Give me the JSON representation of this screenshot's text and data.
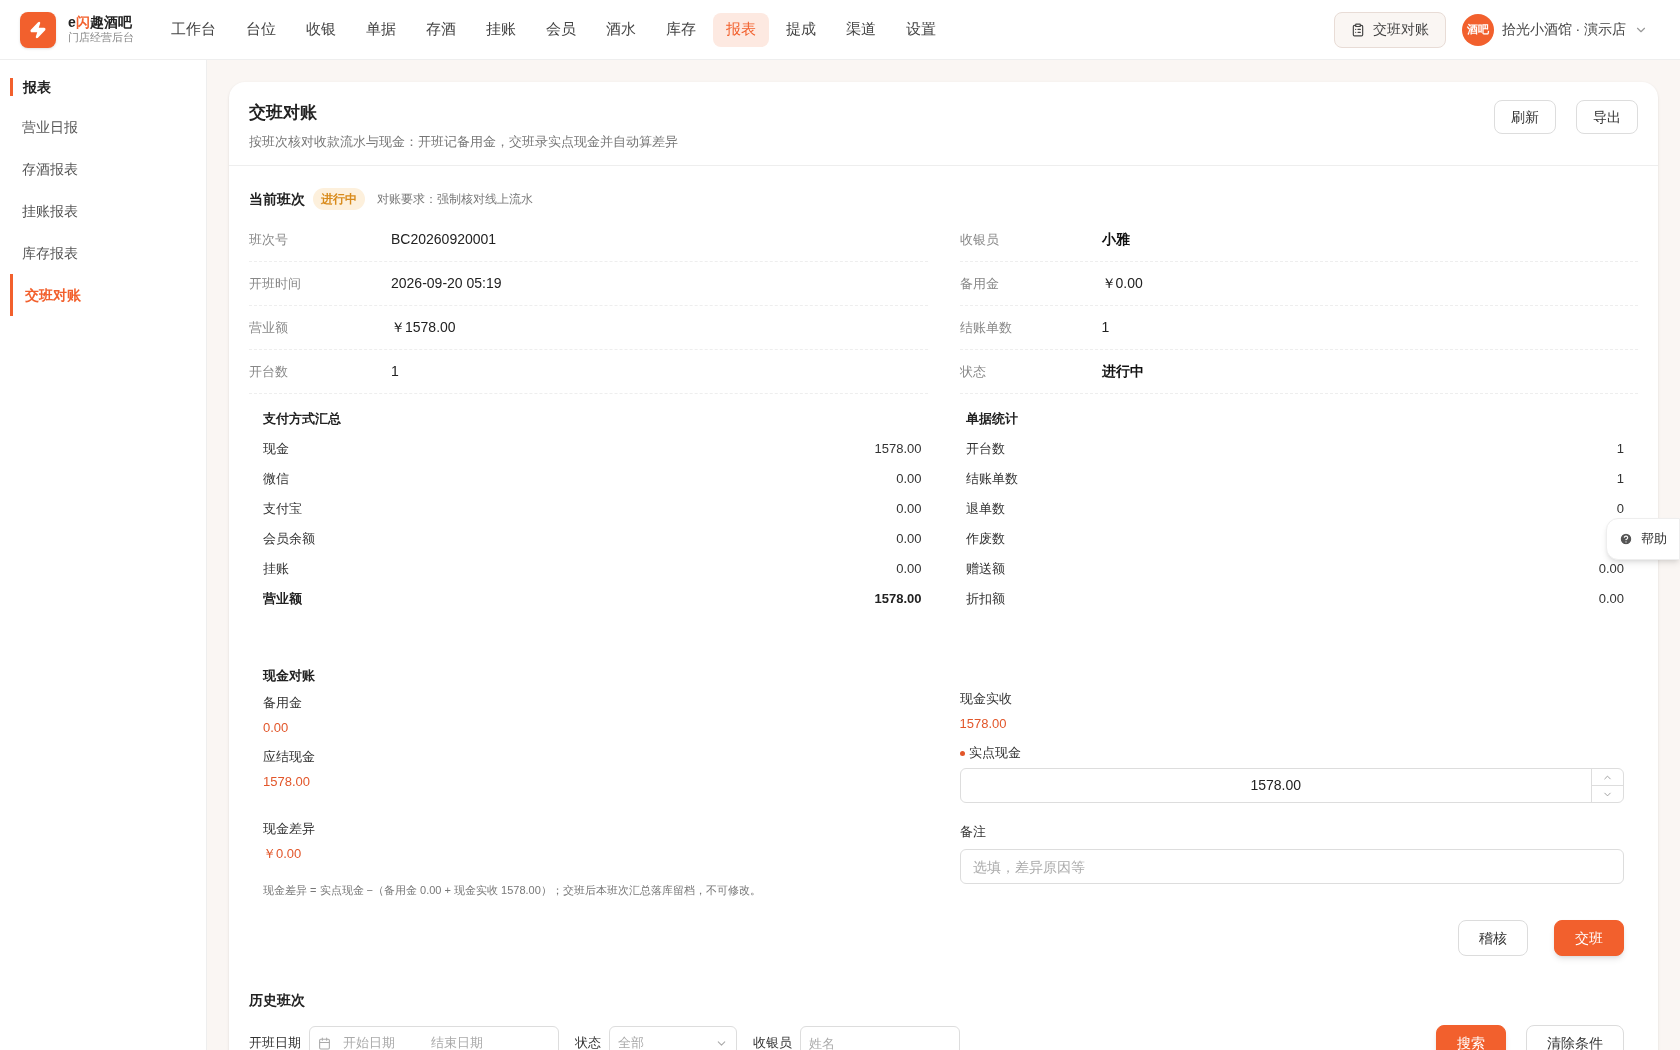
{
  "brand": {
    "title_parts": [
      {
        "text": "e",
        "accent": false
      },
      {
        "text": "闪",
        "accent": true
      },
      {
        "text": "趣酒吧",
        "accent": false
      }
    ],
    "subtitle": "门店经营后台"
  },
  "nav": [
    {
      "label": "工作台",
      "selected": false
    },
    {
      "label": "台位",
      "selected": false
    },
    {
      "label": "收银",
      "selected": false
    },
    {
      "label": "单据",
      "selected": false
    },
    {
      "label": "存酒",
      "selected": false
    },
    {
      "label": "挂账",
      "selected": false
    },
    {
      "label": "会员",
      "selected": false
    },
    {
      "label": "酒水",
      "selected": false
    },
    {
      "label": "库存",
      "selected": false
    },
    {
      "label": "报表",
      "selected": true
    },
    {
      "label": "提成",
      "selected": false
    },
    {
      "label": "渠道",
      "selected": false
    },
    {
      "label": "设置",
      "selected": false
    }
  ],
  "header_right": {
    "shift_button": "交班对账",
    "avatar": "酒吧",
    "store": "拾光小酒馆 · 演示店"
  },
  "sidebar": {
    "section": "报表",
    "items": [
      {
        "label": "营业日报",
        "selected": false
      },
      {
        "label": "存酒报表",
        "selected": false
      },
      {
        "label": "挂账报表",
        "selected": false
      },
      {
        "label": "库存报表",
        "selected": false
      },
      {
        "label": "交班对账",
        "selected": true
      }
    ]
  },
  "card": {
    "title": "交班对账",
    "subtitle": "按班次核对收款流水与现金：开班记备用金，交班录实点现金并自动算差异",
    "actions": [
      "刷新",
      "导出"
    ]
  },
  "current": {
    "label": "当前班次",
    "status": "进行中",
    "requirement": "对账要求：强制核对线上流水"
  },
  "info_left": [
    {
      "label": "班次号",
      "value": "BC20260920001",
      "emphasis": false
    },
    {
      "label": "开班时间",
      "value": "2026-09-20 05:19",
      "emphasis": false
    },
    {
      "label": "营业额",
      "value": "￥1578.00",
      "emphasis": false
    },
    {
      "label": "开台数",
      "value": "1",
      "emphasis": false
    }
  ],
  "info_right": [
    {
      "label": "收银员",
      "value": "小雅",
      "emphasis": true
    },
    {
      "label": "备用金",
      "value": "￥0.00",
      "emphasis": false
    },
    {
      "label": "结账单数",
      "value": "1",
      "emphasis": false
    },
    {
      "label": "状态",
      "value": "进行中",
      "emphasis": true
    }
  ],
  "payment_summary": {
    "title": "支付方式汇总",
    "rows": [
      {
        "label": "现金",
        "value": "1578.00",
        "total": false
      },
      {
        "label": "微信",
        "value": "0.00",
        "total": false
      },
      {
        "label": "支付宝",
        "value": "0.00",
        "total": false
      },
      {
        "label": "会员余额",
        "value": "0.00",
        "total": false
      },
      {
        "label": "挂账",
        "value": "0.00",
        "total": false
      },
      {
        "label": "营业额",
        "value": "1578.00",
        "total": true
      }
    ]
  },
  "doc_stats": {
    "title": "单据统计",
    "rows": [
      {
        "label": "开台数",
        "value": "1"
      },
      {
        "label": "结账单数",
        "value": "1"
      },
      {
        "label": "退单数",
        "value": "0"
      },
      {
        "label": "作废数"
      },
      {
        "label": "赠送额",
        "value": "0.00"
      },
      {
        "label": "折扣额",
        "value": "0.00"
      }
    ]
  },
  "cash": {
    "title": "现金对账",
    "left": [
      {
        "label": "备用金",
        "value": "0.00"
      },
      {
        "label": "应结现金",
        "value": "1578.00"
      },
      {
        "label": "现金差异",
        "value": "￥0.00"
      }
    ],
    "received": {
      "label": "现金实收",
      "value": "1578.00"
    },
    "counted": {
      "label": "实点现金",
      "required": true,
      "value": "1578.00"
    },
    "note": {
      "label": "备注",
      "placeholder": "选填，差异原因等"
    },
    "formula": "现金差异 = 实点现金 −（备用金 0.00 + 现金实收 1578.00）；交班后本班次汇总落库留档，不可修改。",
    "buttons": [
      {
        "label": "稽核",
        "kind": "secondary"
      },
      {
        "label": "交班",
        "kind": "primary"
      }
    ]
  },
  "history": {
    "title": "历史班次",
    "filters": [
      {
        "kind": "daterange",
        "label": "开班日期",
        "placeholders": [
          "开始日期",
          "结束日期"
        ]
      },
      {
        "kind": "select",
        "label": "状态",
        "placeholder": "全部"
      },
      {
        "kind": "text",
        "label": "收银员",
        "placeholder": "姓名"
      }
    ],
    "buttons": [
      {
        "label": "搜索",
        "kind": "primary"
      },
      {
        "label": "清除条件",
        "kind": "secondary"
      }
    ]
  },
  "help": "帮助"
}
